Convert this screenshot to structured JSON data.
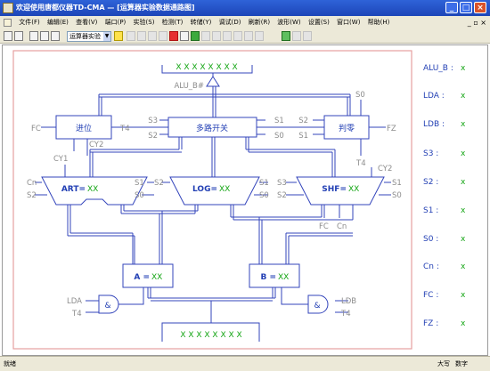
{
  "window": {
    "title": "欢迎使用唐都仪器TD-CMA — [运算器实验数据通路图]",
    "controls": [
      "_",
      "□",
      "×"
    ]
  },
  "menu": {
    "items": [
      "文件(F)",
      "编辑(E)",
      "查看(V)",
      "端口(P)",
      "实验(S)",
      "检测(T)",
      "转储(Y)",
      "调试(D)",
      "刷新(R)",
      "波形(W)",
      "设置(S)",
      "窗口(W)",
      "帮助(H)"
    ],
    "mdi_controls": "_ ▫ ×"
  },
  "toolbar": {
    "mode": "运算器实验"
  },
  "diagram": {
    "top_bus": "X X X X X X X X",
    "bottom_bus": "X X X X X X X X",
    "alu_b": "ALU_B#",
    "mux": "多路开关",
    "carry": "进位",
    "zero": "判零",
    "and_symbol": "&",
    "art": {
      "label": "ART=",
      "value": "XX"
    },
    "log": {
      "label": "LOG=",
      "value": "XX"
    },
    "shf": {
      "label": "SHF=",
      "value": "XX"
    },
    "reg_a": {
      "label": "A =",
      "value": "XX"
    },
    "reg_b": {
      "label": "B =",
      "value": "XX"
    },
    "signals": {
      "s0": "S0",
      "s1": "S1",
      "s2": "S2",
      "s3": "S3",
      "cn": "Cn",
      "fc": "FC",
      "fz": "FZ",
      "t4": "T4",
      "cy1": "CY1",
      "cy2": "CY2",
      "lda": "LDA",
      "ldb": "LDB"
    }
  },
  "panel": [
    {
      "label": "ALU_B :",
      "value": "x"
    },
    {
      "label": "LDA :",
      "value": "x"
    },
    {
      "label": "LDB :",
      "value": "x"
    },
    {
      "label": "S3 :",
      "value": "x"
    },
    {
      "label": "S2 :",
      "value": "x"
    },
    {
      "label": "S1 :",
      "value": "x"
    },
    {
      "label": "S0 :",
      "value": "x"
    },
    {
      "label": "Cn :",
      "value": "x"
    },
    {
      "label": "FC :",
      "value": "x"
    },
    {
      "label": "FZ :",
      "value": "x"
    }
  ],
  "status": {
    "left": "就绪",
    "caps": "大写",
    "num": "数字"
  },
  "colors": {
    "wire": "#3344bb",
    "block": "#223fb4",
    "value": "#14a514",
    "label": "#8c8c8c",
    "frame": "#e7a0a0"
  }
}
